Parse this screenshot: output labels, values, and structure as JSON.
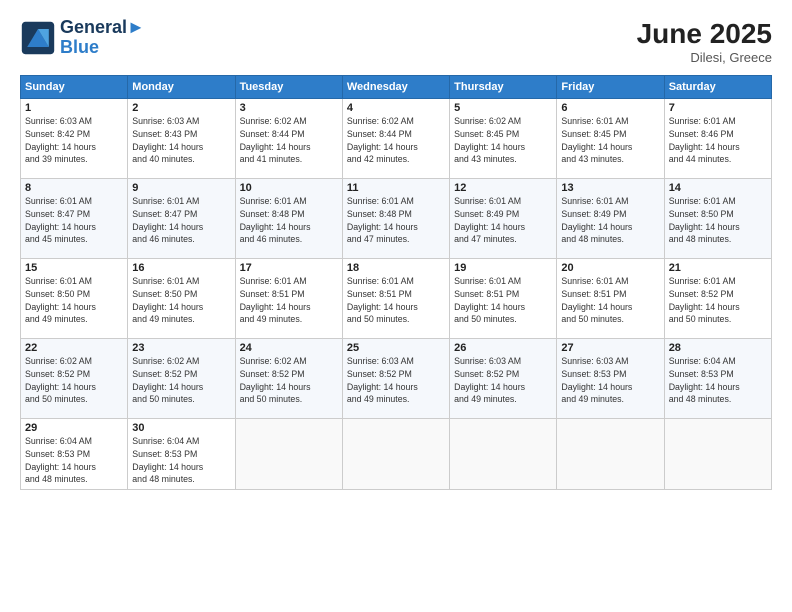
{
  "header": {
    "logo_line1": "General",
    "logo_line2": "Blue",
    "month": "June 2025",
    "location": "Dilesi, Greece"
  },
  "weekdays": [
    "Sunday",
    "Monday",
    "Tuesday",
    "Wednesday",
    "Thursday",
    "Friday",
    "Saturday"
  ],
  "weeks": [
    [
      {
        "day": 1,
        "info": "Sunrise: 6:03 AM\nSunset: 8:42 PM\nDaylight: 14 hours\nand 39 minutes."
      },
      {
        "day": 2,
        "info": "Sunrise: 6:03 AM\nSunset: 8:43 PM\nDaylight: 14 hours\nand 40 minutes."
      },
      {
        "day": 3,
        "info": "Sunrise: 6:02 AM\nSunset: 8:44 PM\nDaylight: 14 hours\nand 41 minutes."
      },
      {
        "day": 4,
        "info": "Sunrise: 6:02 AM\nSunset: 8:44 PM\nDaylight: 14 hours\nand 42 minutes."
      },
      {
        "day": 5,
        "info": "Sunrise: 6:02 AM\nSunset: 8:45 PM\nDaylight: 14 hours\nand 43 minutes."
      },
      {
        "day": 6,
        "info": "Sunrise: 6:01 AM\nSunset: 8:45 PM\nDaylight: 14 hours\nand 43 minutes."
      },
      {
        "day": 7,
        "info": "Sunrise: 6:01 AM\nSunset: 8:46 PM\nDaylight: 14 hours\nand 44 minutes."
      }
    ],
    [
      {
        "day": 8,
        "info": "Sunrise: 6:01 AM\nSunset: 8:47 PM\nDaylight: 14 hours\nand 45 minutes."
      },
      {
        "day": 9,
        "info": "Sunrise: 6:01 AM\nSunset: 8:47 PM\nDaylight: 14 hours\nand 46 minutes."
      },
      {
        "day": 10,
        "info": "Sunrise: 6:01 AM\nSunset: 8:48 PM\nDaylight: 14 hours\nand 46 minutes."
      },
      {
        "day": 11,
        "info": "Sunrise: 6:01 AM\nSunset: 8:48 PM\nDaylight: 14 hours\nand 47 minutes."
      },
      {
        "day": 12,
        "info": "Sunrise: 6:01 AM\nSunset: 8:49 PM\nDaylight: 14 hours\nand 47 minutes."
      },
      {
        "day": 13,
        "info": "Sunrise: 6:01 AM\nSunset: 8:49 PM\nDaylight: 14 hours\nand 48 minutes."
      },
      {
        "day": 14,
        "info": "Sunrise: 6:01 AM\nSunset: 8:50 PM\nDaylight: 14 hours\nand 48 minutes."
      }
    ],
    [
      {
        "day": 15,
        "info": "Sunrise: 6:01 AM\nSunset: 8:50 PM\nDaylight: 14 hours\nand 49 minutes."
      },
      {
        "day": 16,
        "info": "Sunrise: 6:01 AM\nSunset: 8:50 PM\nDaylight: 14 hours\nand 49 minutes."
      },
      {
        "day": 17,
        "info": "Sunrise: 6:01 AM\nSunset: 8:51 PM\nDaylight: 14 hours\nand 49 minutes."
      },
      {
        "day": 18,
        "info": "Sunrise: 6:01 AM\nSunset: 8:51 PM\nDaylight: 14 hours\nand 50 minutes."
      },
      {
        "day": 19,
        "info": "Sunrise: 6:01 AM\nSunset: 8:51 PM\nDaylight: 14 hours\nand 50 minutes."
      },
      {
        "day": 20,
        "info": "Sunrise: 6:01 AM\nSunset: 8:51 PM\nDaylight: 14 hours\nand 50 minutes."
      },
      {
        "day": 21,
        "info": "Sunrise: 6:01 AM\nSunset: 8:52 PM\nDaylight: 14 hours\nand 50 minutes."
      }
    ],
    [
      {
        "day": 22,
        "info": "Sunrise: 6:02 AM\nSunset: 8:52 PM\nDaylight: 14 hours\nand 50 minutes."
      },
      {
        "day": 23,
        "info": "Sunrise: 6:02 AM\nSunset: 8:52 PM\nDaylight: 14 hours\nand 50 minutes."
      },
      {
        "day": 24,
        "info": "Sunrise: 6:02 AM\nSunset: 8:52 PM\nDaylight: 14 hours\nand 50 minutes."
      },
      {
        "day": 25,
        "info": "Sunrise: 6:03 AM\nSunset: 8:52 PM\nDaylight: 14 hours\nand 49 minutes."
      },
      {
        "day": 26,
        "info": "Sunrise: 6:03 AM\nSunset: 8:52 PM\nDaylight: 14 hours\nand 49 minutes."
      },
      {
        "day": 27,
        "info": "Sunrise: 6:03 AM\nSunset: 8:53 PM\nDaylight: 14 hours\nand 49 minutes."
      },
      {
        "day": 28,
        "info": "Sunrise: 6:04 AM\nSunset: 8:53 PM\nDaylight: 14 hours\nand 48 minutes."
      }
    ],
    [
      {
        "day": 29,
        "info": "Sunrise: 6:04 AM\nSunset: 8:53 PM\nDaylight: 14 hours\nand 48 minutes."
      },
      {
        "day": 30,
        "info": "Sunrise: 6:04 AM\nSunset: 8:53 PM\nDaylight: 14 hours\nand 48 minutes."
      },
      null,
      null,
      null,
      null,
      null
    ]
  ]
}
